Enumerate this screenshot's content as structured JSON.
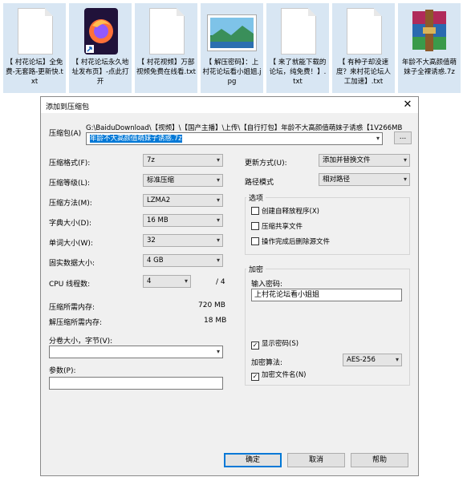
{
  "files": [
    {
      "label": "【 村花论坛】全免费-无套路-更新快.txt",
      "icon": "text-file-icon"
    },
    {
      "label": "【 村花论坛永久地址发布页】-点此打开",
      "icon": "firefox-shortcut-icon"
    },
    {
      "label": "【 村花视频】万部视频免费在线看.txt",
      "icon": "text-file-icon"
    },
    {
      "label": "【 解压密码】：上村花论坛看小姐姐.jpg",
      "icon": "image-file-icon"
    },
    {
      "label": "【 来了就能下载的论坛，纯免费！】.txt",
      "icon": "text-file-icon"
    },
    {
      "label": "【 有种子却没速度？来村花论坛人工加速】.txt",
      "icon": "text-file-icon"
    },
    {
      "label": "年龄不大高颜值萌妹子全裸诱惑.7z",
      "icon": "winrar-archive-icon"
    }
  ],
  "dialog": {
    "title": "添加到压缩包",
    "close": "✕",
    "archive_label": "压缩包(A)",
    "archive_path": "G:\\BaiduDownload\\【视频】\\【国产主播】\\上传\\【自行打包】年龄不大高颜值萌妹子诱惑【1V266MB",
    "archive_name": "年龄不大高颜值萌妹子诱惑.7z",
    "browse": "...",
    "left": [
      {
        "label": "压缩格式(F):",
        "value": "7z"
      },
      {
        "label": "压缩等级(L):",
        "value": "标准压缩"
      },
      {
        "label": "压缩方法(M):",
        "value": "LZMA2"
      },
      {
        "label": "字典大小(D):",
        "value": "16 MB"
      },
      {
        "label": "单词大小(W):",
        "value": "32"
      },
      {
        "label": "固实数据大小:",
        "value": "4 GB"
      }
    ],
    "cpu_label": "CPU 线程数:",
    "cpu_value": "4",
    "cpu_total": "/ 4",
    "mem_compress_label": "压缩所需内存:",
    "mem_compress_value": "720 MB",
    "mem_decompress_label": "解压缩所需内存:",
    "mem_decompress_value": "18 MB",
    "split_label": "分卷大小，字节(V):",
    "split_value": "",
    "params_label": "参数(P):",
    "params_value": "",
    "update_label": "更新方式(U):",
    "update_value": "添加并替换文件",
    "path_label": "路径模式",
    "path_value": "相对路径",
    "options_label": "选项",
    "options": [
      {
        "label": "创建自释放程序(X)",
        "checked": false
      },
      {
        "label": "压缩共享文件",
        "checked": false
      },
      {
        "label": "操作完成后删除源文件",
        "checked": false
      }
    ],
    "encrypt_label": "加密",
    "password_label": "输入密码:",
    "password_value": "上村花论坛看小姐姐",
    "show_password_label": "显示密码(S)",
    "show_password_checked": true,
    "encrypt_method_label": "加密算法:",
    "encrypt_method_value": "AES-256",
    "encrypt_names_label": "加密文件名(N)",
    "encrypt_names_checked": true,
    "ok": "确定",
    "cancel": "取消",
    "help": "帮助",
    "check_mark": "✓"
  }
}
